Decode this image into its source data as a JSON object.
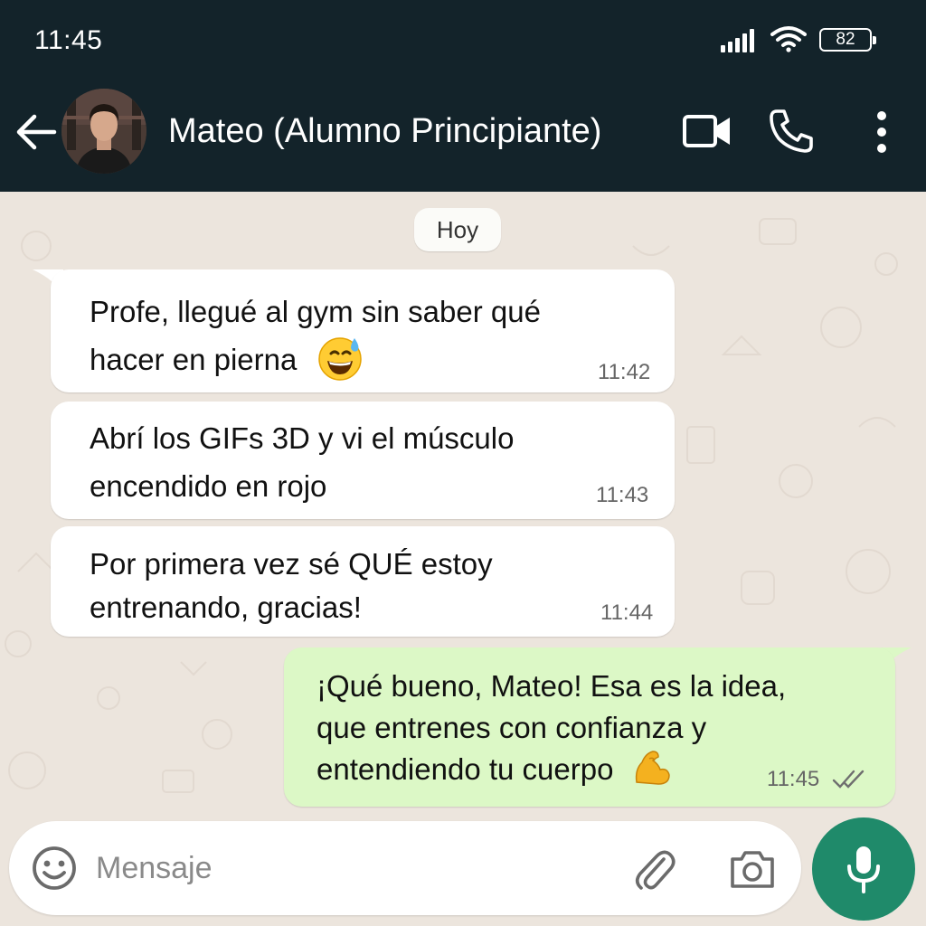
{
  "status_bar": {
    "time": "11:45",
    "battery": "82"
  },
  "header": {
    "contact_name": "Mateo (Alumno Principiante)"
  },
  "chat": {
    "date_label": "Hoy",
    "messages": [
      {
        "direction": "in",
        "lines": [
          "Profe, llegué al gym sin saber qué",
          "hacer en pierna"
        ],
        "emoji": "grinning-face-with-sweat",
        "time": "11:42"
      },
      {
        "direction": "in",
        "lines": [
          "Abrí los GIFs 3D y vi el músculo",
          "encendido en rojo"
        ],
        "time": "11:43"
      },
      {
        "direction": "in",
        "lines": [
          "Por primera vez sé QUÉ estoy",
          "entrenando, gracias!"
        ],
        "time": "11:44"
      },
      {
        "direction": "out",
        "lines": [
          "¡Qué bueno, Mateo! Esa es la idea,",
          "que entrenes con confianza y",
          "entendiendo tu cuerpo"
        ],
        "emoji": "flexed-biceps",
        "time": "11:45",
        "status": "read-double-check"
      }
    ]
  },
  "composer": {
    "placeholder": "Mensaje"
  },
  "colors": {
    "header_bg": "#13232a",
    "chat_bg": "#ece5dd",
    "incoming_bubble": "#ffffff",
    "outgoing_bubble": "#dcf8c6",
    "mic_button": "#1f8a6a"
  },
  "icons": [
    "signal-icon",
    "wifi-icon",
    "battery-icon",
    "back-arrow-icon",
    "video-call-icon",
    "phone-call-icon",
    "more-options-icon",
    "emoji-icon",
    "attach-icon",
    "camera-icon",
    "mic-icon"
  ]
}
